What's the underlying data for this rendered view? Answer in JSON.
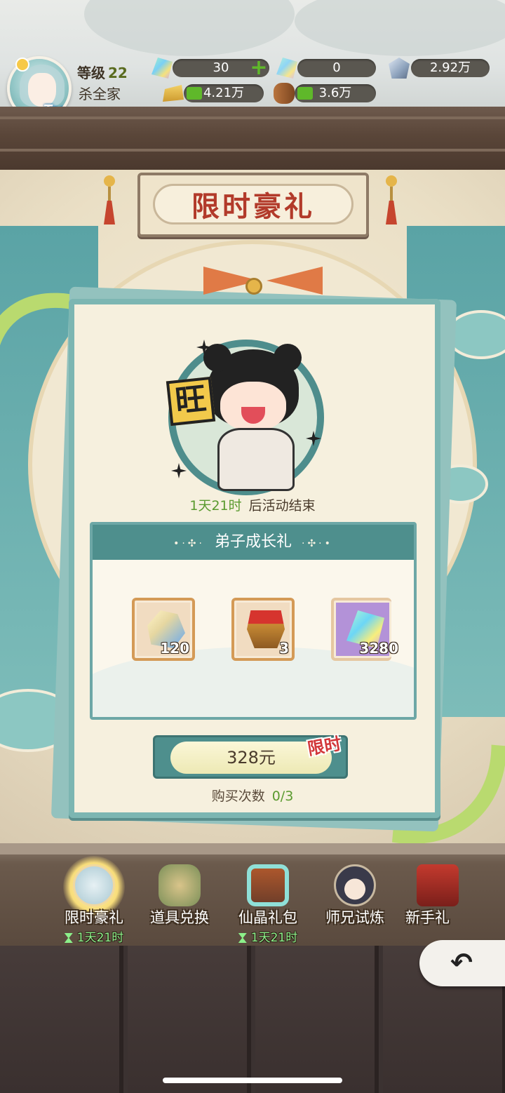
{
  "player": {
    "level_label": "等级",
    "level": "22",
    "name": "杀全家",
    "avatar_badge": "Tap"
  },
  "resources": {
    "crystal": "30",
    "bound_crystal": "0",
    "stone": "2.92万",
    "gold": "4.21万",
    "wood": "3.6万"
  },
  "page": {
    "title": "限时豪礼"
  },
  "event": {
    "countdown_time": "1天21时",
    "countdown_suffix": "后活动结束",
    "pack_title": "弟子成长礼",
    "items": [
      {
        "icon": "spirit-stone-icon",
        "count": "120"
      },
      {
        "icon": "treasure-chest-icon",
        "count": "3"
      },
      {
        "icon": "crystal-icon",
        "count": "3280"
      }
    ],
    "price": "328元",
    "limited_tag": "限时",
    "purchase_label": "购买次数",
    "purchase_count": "0/3"
  },
  "tabs": [
    {
      "label": "限时豪礼",
      "timer": "1天21时",
      "icon": "fox-girl-icon"
    },
    {
      "label": "道具兑换",
      "timer": "",
      "icon": "item-basket-icon"
    },
    {
      "label": "仙晶礼包",
      "timer": "1天21时",
      "icon": "crystal-chest-icon"
    },
    {
      "label": "师兄试炼",
      "timer": "",
      "icon": "senior-disciple-icon"
    },
    {
      "label": "新手礼",
      "timer": "",
      "icon": "newbie-gift-icon"
    }
  ],
  "colors": {
    "accent_teal": "#4e8f8d",
    "title_red": "#b23a2a",
    "timer_green": "#5a9a2f"
  }
}
